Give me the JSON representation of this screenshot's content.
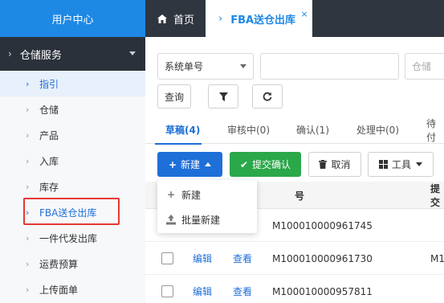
{
  "sidebar": {
    "header": "用户中心",
    "section": "仓储服务",
    "items": [
      {
        "label": "指引"
      },
      {
        "label": "仓储"
      },
      {
        "label": "产品"
      },
      {
        "label": "入库"
      },
      {
        "label": "库存"
      },
      {
        "label": "FBA送仓出库"
      },
      {
        "label": "一件代发出库"
      },
      {
        "label": "运费预算"
      },
      {
        "label": "上传面单"
      }
    ]
  },
  "tabs": {
    "home": "首页",
    "active": "FBA送仓出库",
    "close": "×"
  },
  "search": {
    "select_value": "系统单号",
    "input_value": "",
    "warehouse_placeholder": "仓储",
    "query_label": "查询"
  },
  "status_tabs": [
    {
      "label": "草稿(4)"
    },
    {
      "label": "审核中(0)"
    },
    {
      "label": "确认(1)"
    },
    {
      "label": "处理中(0)"
    },
    {
      "label": "待付"
    }
  ],
  "actions": {
    "new_label": "新建",
    "submit_label": "提交确认",
    "cancel_label": "取消",
    "tools_label": "工具"
  },
  "dropdown": {
    "items": [
      {
        "label": "新建"
      },
      {
        "label": "批量新建"
      }
    ]
  },
  "table": {
    "headers": [
      "号",
      "提交"
    ],
    "rows": [
      {
        "edit": "编辑",
        "view": "查看",
        "order": "M100010000961745",
        "extra": ""
      },
      {
        "edit": "编辑",
        "view": "查看",
        "order": "M100010000961730",
        "extra": "M1"
      },
      {
        "edit": "编辑",
        "view": "查看",
        "order": "M100010000957811",
        "extra": ""
      }
    ]
  },
  "colors": {
    "accent": "#1e6fd8",
    "success": "#2aa84a",
    "sidebar_bg": "#2f3640",
    "highlight": "#e53935"
  }
}
